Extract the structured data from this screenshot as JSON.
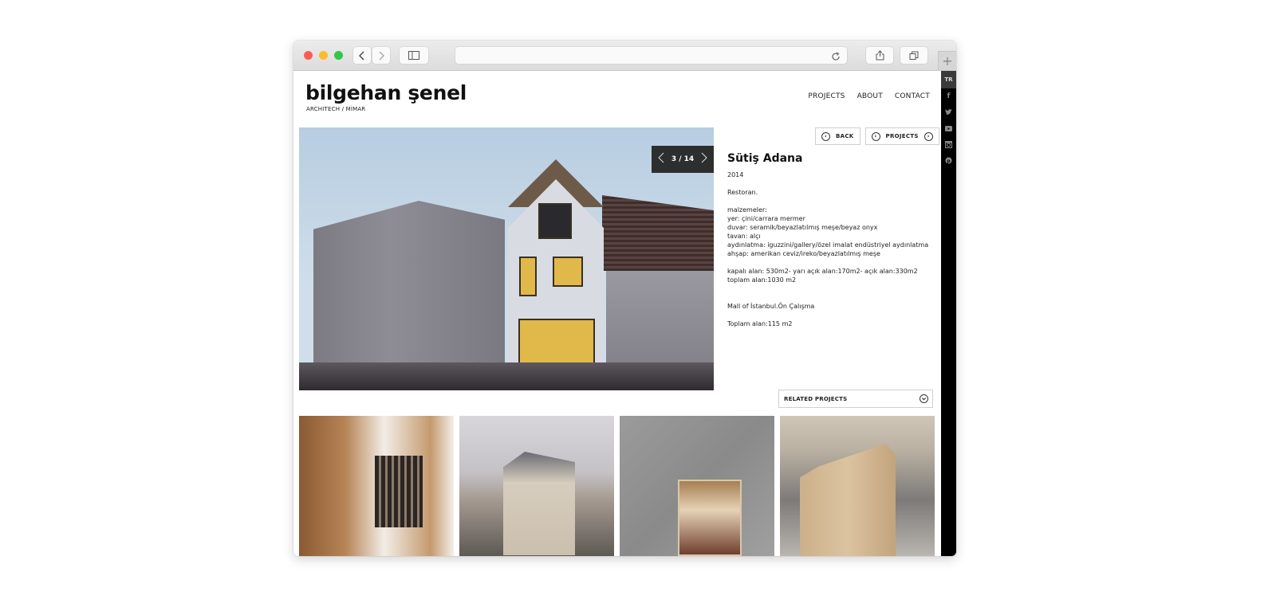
{
  "browser": {
    "url": "",
    "icons": {
      "back": "chevron-left-icon",
      "forward": "chevron-right-icon",
      "sidebar": "sidebar-icon",
      "reload": "reload-icon",
      "share": "share-icon",
      "tabs": "tabs-icon",
      "new_tab": "plus-icon"
    }
  },
  "site": {
    "logo": "bilgehan şenel",
    "tagline": "ARCHITECH / MİMAR",
    "nav": [
      "PROJECTS",
      "ABOUT",
      "CONTACT"
    ],
    "language": "TR",
    "social": [
      "facebook",
      "twitter",
      "youtube",
      "instagram",
      "pinterest"
    ]
  },
  "gallery": {
    "current": 3,
    "total": 14,
    "counter": "3 / 14"
  },
  "buttons": {
    "back": "BACK",
    "projects": "PROJECTS"
  },
  "project": {
    "title": "Sütiş Adana",
    "year": "2014",
    "type": "Restoran.",
    "materials": "malzemeler:\nyer: çini/carrara mermer\nduvar: seramik/beyazlatılmış meşe/beyaz onyx\ntavan: alçı\naydınlatma: iguzzini/gallery/özel imalat endüstriyel aydınlatma\nahşap: amerikan ceviz/ireko/beyazlatılmış meşe",
    "area": "kapalı alan: 530m2- yarı açık alan:170m2- açık alan:330m2\ntoplam alan:1030 m2",
    "extra_title": "Mall of İstanbul.Ön Çalışma",
    "extra_area": "Toplam alan:115 m2"
  },
  "related": {
    "label": "RELATED PROJECTS",
    "thumbnails": [
      "related-project-1",
      "related-project-2",
      "related-project-3",
      "related-project-4"
    ]
  }
}
